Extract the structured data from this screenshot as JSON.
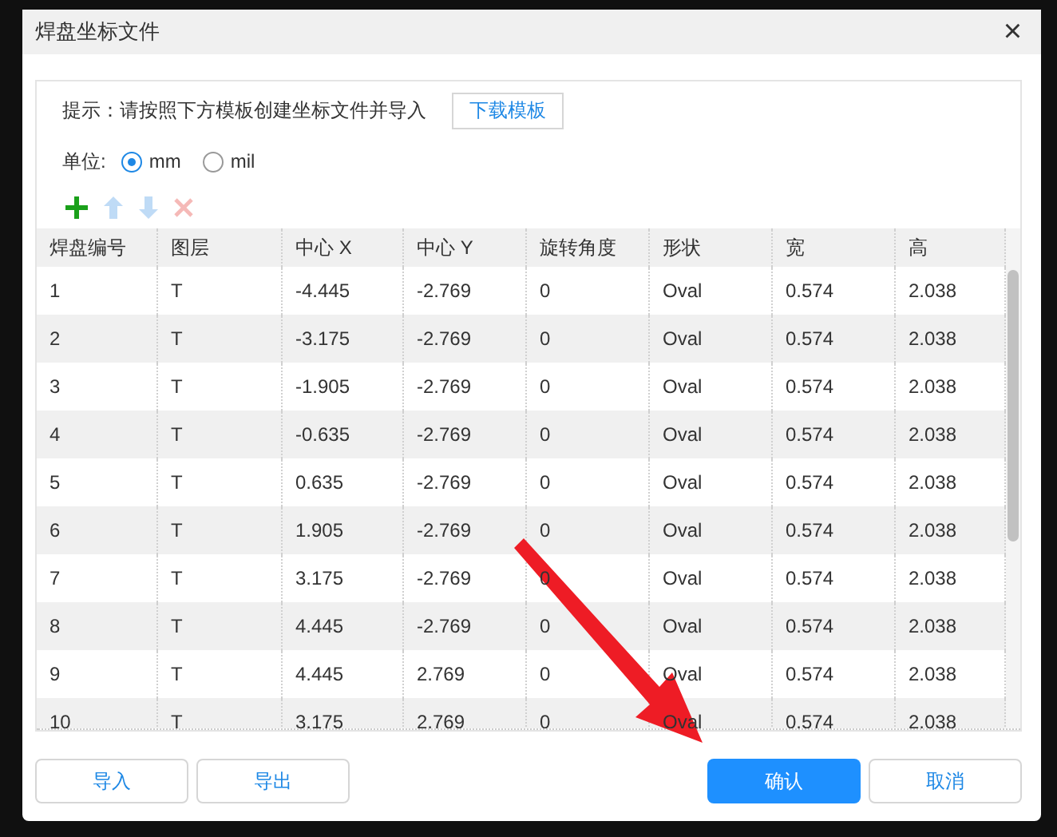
{
  "window": {
    "title": "焊盘坐标文件",
    "close": "×"
  },
  "hint": {
    "text": "提示：请按照下方模板创建坐标文件并导入",
    "button": "下载模板"
  },
  "unit": {
    "label": "单位:",
    "options": [
      {
        "label": "mm",
        "selected": true
      },
      {
        "label": "mil",
        "selected": false
      }
    ]
  },
  "toolbar": [
    {
      "kind": "add",
      "disabled": false
    },
    {
      "kind": "up",
      "disabled": true
    },
    {
      "kind": "down",
      "disabled": true
    },
    {
      "kind": "delete",
      "disabled": true
    }
  ],
  "table": {
    "columns": [
      "焊盘编号",
      "图层",
      "中心 X",
      "中心 Y",
      "旋转角度",
      "形状",
      "宽",
      "高"
    ],
    "rows": [
      [
        "1",
        "T",
        "-4.445",
        "-2.769",
        "0",
        "Oval",
        "0.574",
        "2.038"
      ],
      [
        "2",
        "T",
        "-3.175",
        "-2.769",
        "0",
        "Oval",
        "0.574",
        "2.038"
      ],
      [
        "3",
        "T",
        "-1.905",
        "-2.769",
        "0",
        "Oval",
        "0.574",
        "2.038"
      ],
      [
        "4",
        "T",
        "-0.635",
        "-2.769",
        "0",
        "Oval",
        "0.574",
        "2.038"
      ],
      [
        "5",
        "T",
        "0.635",
        "-2.769",
        "0",
        "Oval",
        "0.574",
        "2.038"
      ],
      [
        "6",
        "T",
        "1.905",
        "-2.769",
        "0",
        "Oval",
        "0.574",
        "2.038"
      ],
      [
        "7",
        "T",
        "3.175",
        "-2.769",
        "0",
        "Oval",
        "0.574",
        "2.038"
      ],
      [
        "8",
        "T",
        "4.445",
        "-2.769",
        "0",
        "Oval",
        "0.574",
        "2.038"
      ],
      [
        "9",
        "T",
        "4.445",
        "2.769",
        "0",
        "Oval",
        "0.574",
        "2.038"
      ],
      [
        "10",
        "T",
        "3.175",
        "2.769",
        "0",
        "Oval",
        "0.574",
        "2.038"
      ]
    ]
  },
  "buttons": [
    {
      "label": "导入",
      "kind": "secondary"
    },
    {
      "label": "导出",
      "kind": "secondary"
    },
    {
      "label": "确认",
      "kind": "primary"
    },
    {
      "label": "取消",
      "kind": "secondary"
    }
  ]
}
